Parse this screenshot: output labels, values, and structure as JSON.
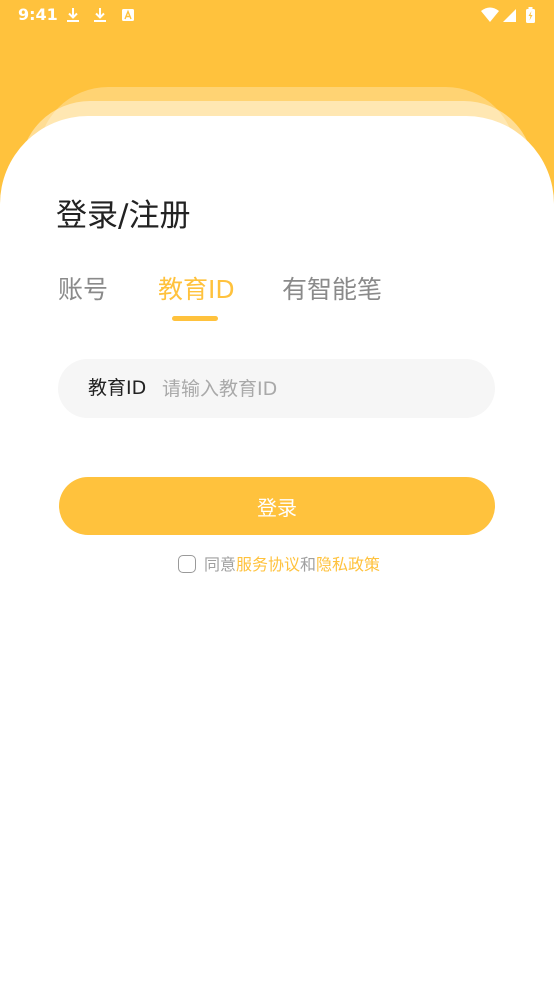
{
  "status_bar": {
    "time": "9:41",
    "icons": [
      "download-icon",
      "download-icon",
      "a-icon",
      "wifi-icon",
      "signal-icon",
      "battery-icon"
    ]
  },
  "colors": {
    "accent": "#FFC23D",
    "text_primary": "#222222",
    "text_muted": "#8a8a8a",
    "input_bg": "#f6f6f6"
  },
  "page": {
    "title": "登录/注册"
  },
  "tabs": [
    {
      "label": "账号",
      "active": false
    },
    {
      "label": "教育ID",
      "active": true
    },
    {
      "label": "有智能笔",
      "active": false
    }
  ],
  "input": {
    "label": "教育ID",
    "value": "",
    "placeholder": "请输入教育ID"
  },
  "login_button": {
    "label": "登录"
  },
  "agreement": {
    "checked": false,
    "prefix": "同意",
    "service_link": "服务协议",
    "connector": "和",
    "privacy_link": "隐私政策"
  }
}
